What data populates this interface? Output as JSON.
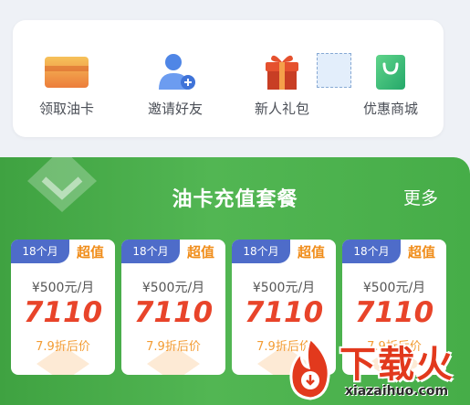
{
  "quick_actions": [
    {
      "label": "领取油卡",
      "icon": "card-icon"
    },
    {
      "label": "邀请好友",
      "icon": "add-user-icon"
    },
    {
      "label": "新人礼包",
      "icon": "gift-icon"
    },
    {
      "label": "优惠商城",
      "icon": "shopping-bag-icon"
    }
  ],
  "packages": {
    "title": "油卡充值套餐",
    "more_label": "更多",
    "plans": [
      {
        "badge": "18个月",
        "tag": "超值",
        "monthly": "¥500元/月",
        "price": "7110",
        "discount": "7.9折后价"
      },
      {
        "badge": "18个月",
        "tag": "超值",
        "monthly": "¥500元/月",
        "price": "7110",
        "discount": "7.9折后价"
      },
      {
        "badge": "18个月",
        "tag": "超值",
        "monthly": "¥500元/月",
        "price": "7110",
        "discount": "7.9折后价"
      },
      {
        "badge": "18个月",
        "tag": "超值",
        "monthly": "¥500元/月",
        "price": "7110",
        "discount": "7.9折后价"
      }
    ]
  },
  "watermark": {
    "text": "下载火",
    "url": "xiazaihuo.com"
  },
  "colors": {
    "green": "#4caf50",
    "price_red": "#e8442a",
    "badge_blue": "#4e6cc9",
    "tag_orange": "#f08d1a"
  }
}
